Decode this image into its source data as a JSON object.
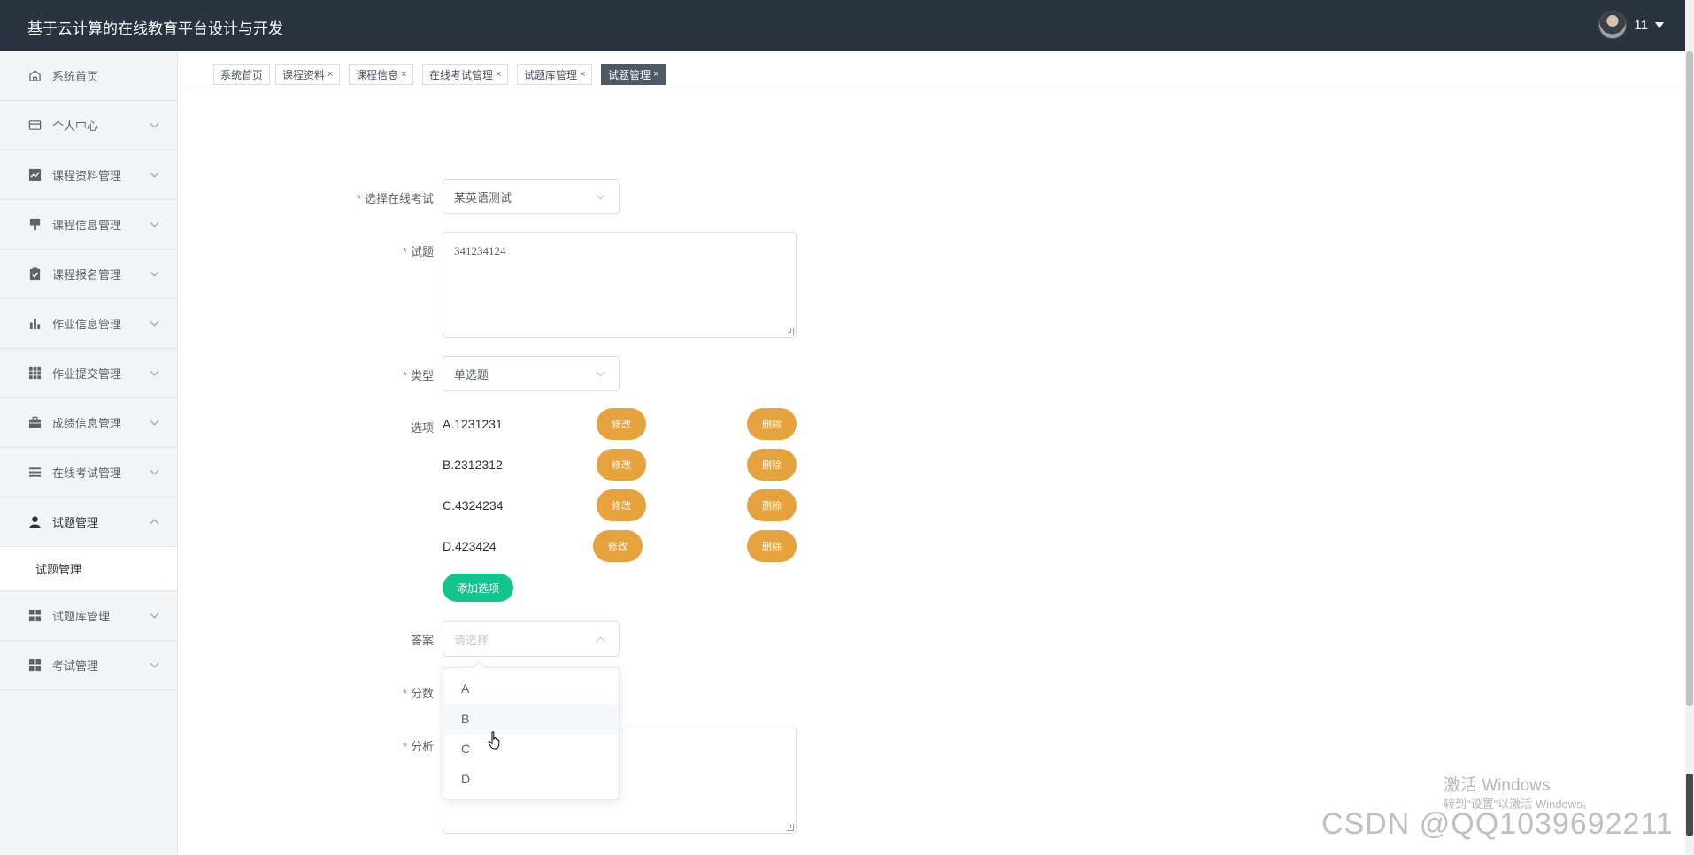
{
  "header": {
    "title": "基于云计算的在线教育平台设计与开发",
    "username": "11"
  },
  "sidebar": {
    "items": [
      {
        "label": "系统首页",
        "icon": "home-icon",
        "expandable": false
      },
      {
        "label": "个人中心",
        "icon": "wallet-icon",
        "expandable": true
      },
      {
        "label": "课程资料管理",
        "icon": "chart-line-icon",
        "expandable": true
      },
      {
        "label": "课程信息管理",
        "icon": "stamp-icon",
        "expandable": true
      },
      {
        "label": "课程报名管理",
        "icon": "clipboard-check-icon",
        "expandable": true
      },
      {
        "label": "作业信息管理",
        "icon": "bar-chart-icon",
        "expandable": true
      },
      {
        "label": "作业提交管理",
        "icon": "grid-icon",
        "expandable": true
      },
      {
        "label": "成绩信息管理",
        "icon": "briefcase-icon",
        "expandable": true
      },
      {
        "label": "在线考试管理",
        "icon": "list-icon",
        "expandable": true
      },
      {
        "label": "试题管理",
        "icon": "user-icon",
        "expandable": true,
        "expanded": true
      },
      {
        "label": "试题库管理",
        "icon": "apps-icon",
        "expandable": true
      },
      {
        "label": "考试管理",
        "icon": "apps-icon",
        "expandable": true
      }
    ],
    "submenu": {
      "label": "试题管理"
    }
  },
  "tabs": [
    {
      "label": "系统首页",
      "closable": false
    },
    {
      "label": "课程资料",
      "closable": true
    },
    {
      "label": "课程信息",
      "closable": true
    },
    {
      "label": "在线考试管理",
      "closable": true
    },
    {
      "label": "试题库管理",
      "closable": true
    },
    {
      "label": "试题管理",
      "closable": true,
      "active": true
    }
  ],
  "tab_close_glyph": "×",
  "form": {
    "exam": {
      "label": "选择在线考试",
      "value": "某英语测试"
    },
    "question": {
      "label": "试题",
      "value": "341234124"
    },
    "type": {
      "label": "类型",
      "value": "单选题"
    },
    "options": {
      "label": "选项",
      "items": [
        "A.1231231",
        "B.2312312",
        "C.4324234",
        "D.423424"
      ],
      "edit_label": "修改",
      "delete_label": "删除",
      "add_label": "添加选项"
    },
    "answer": {
      "label": "答案",
      "placeholder": "请选择",
      "dropdown": [
        "A",
        "B",
        "C",
        "D"
      ],
      "hovered": "B"
    },
    "score": {
      "label": "分数"
    },
    "analysis": {
      "label": "分析"
    }
  },
  "watermarks": {
    "windows_title": "激活 Windows",
    "windows_sub": "转到\"设置\"以激活 Windows。",
    "csdn": "CSDN @QQ1039692211"
  },
  "colors": {
    "header_bg": "#2b3340",
    "accent_orange": "#e6a23c",
    "accent_green": "#13c48e",
    "required_red": "#f56c6c",
    "active_tab": "#4e5868"
  }
}
